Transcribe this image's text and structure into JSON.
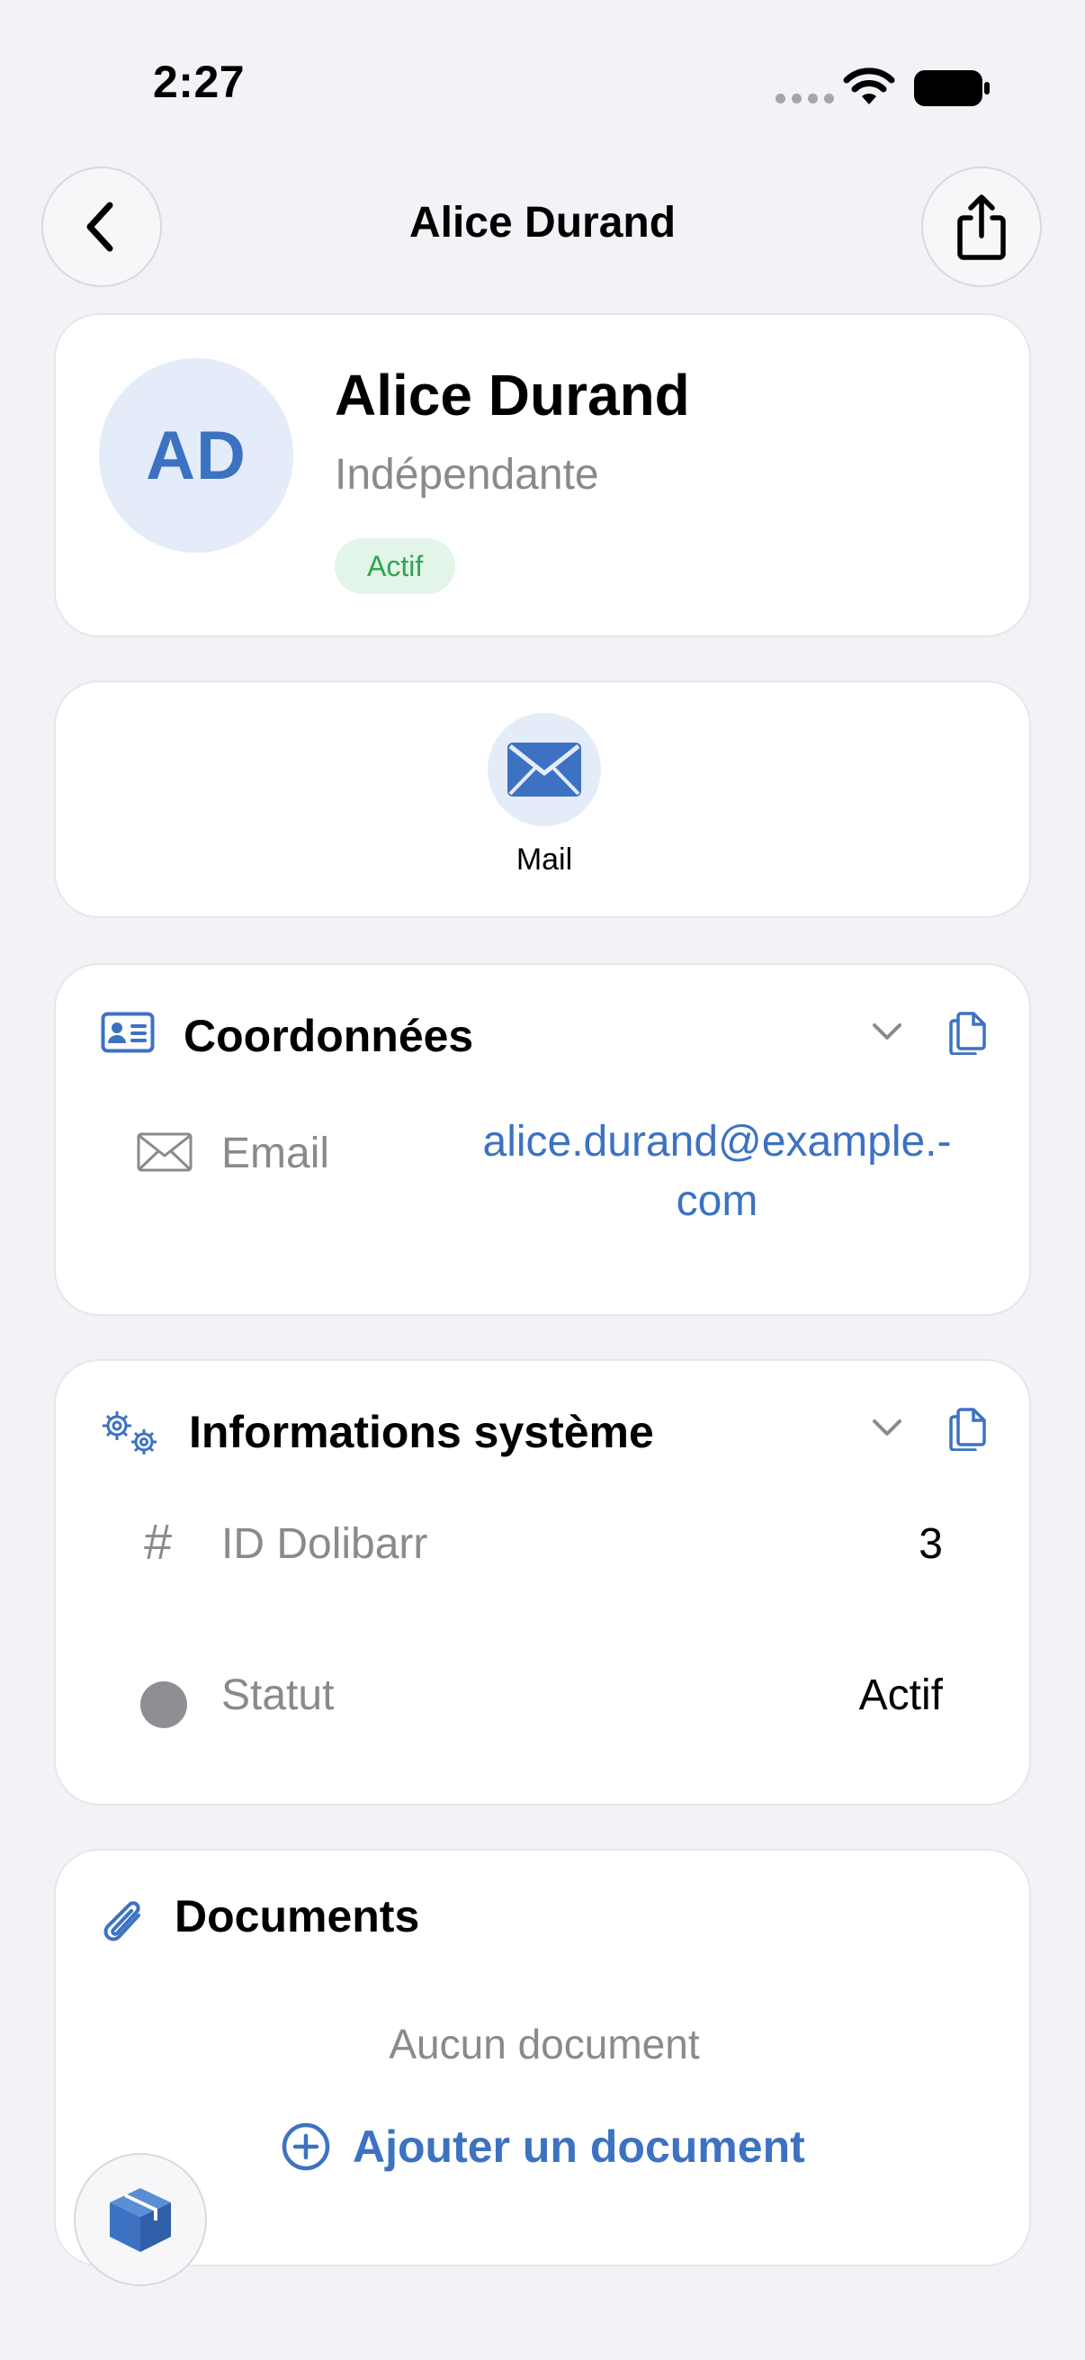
{
  "status_bar": {
    "time": "2:27"
  },
  "nav": {
    "title": "Alice Durand"
  },
  "profile": {
    "initials": "AD",
    "name": "Alice Durand",
    "role": "Indépendante",
    "status_badge": "Actif"
  },
  "actions": [
    {
      "label": "Mail",
      "icon": "envelope-icon"
    }
  ],
  "coordonnees": {
    "title": "Coordonnées",
    "rows": [
      {
        "label": "Email",
        "value_line1": "alice.durand@example.-",
        "value_line2": "com"
      }
    ]
  },
  "system_info": {
    "title": "Informations système",
    "rows": [
      {
        "label": "ID Dolibarr",
        "value": "3"
      },
      {
        "label": "Statut",
        "value": "Actif"
      }
    ]
  },
  "documents": {
    "title": "Documents",
    "empty_text": "Aucun document",
    "add_label": "Ajouter un document"
  },
  "colors": {
    "accent": "#3D72C2",
    "background": "#F2F2F7",
    "badge_green": "#2EA551",
    "badge_green_bg": "#E3F4E8",
    "secondary_text": "#8A8A8E"
  }
}
